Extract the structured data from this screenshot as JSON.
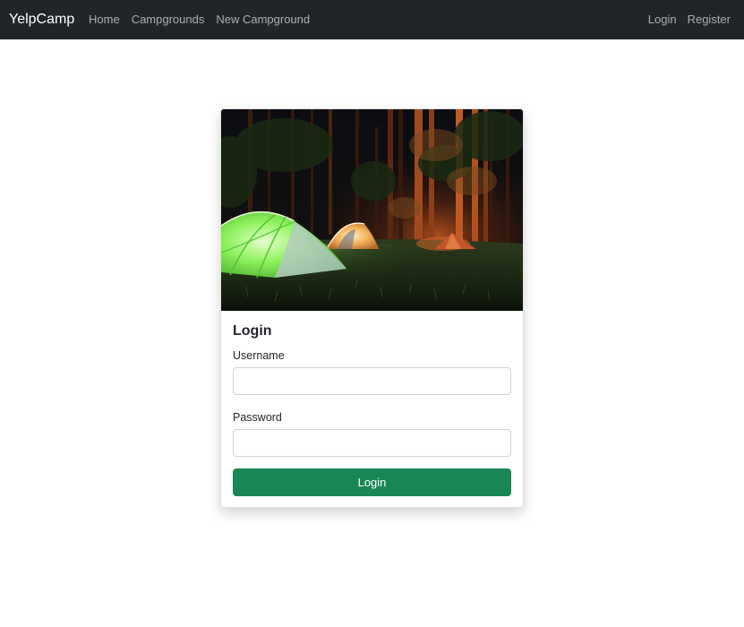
{
  "navbar": {
    "brand": "YelpCamp",
    "left_links": [
      "Home",
      "Campgrounds",
      "New Campground"
    ],
    "right_links": [
      "Login",
      "Register"
    ]
  },
  "login_card": {
    "image": "night-campsite-tents-forest-photo",
    "title": "Login",
    "username_label": "Username",
    "username_value": "",
    "password_label": "Password",
    "password_value": "",
    "submit_label": "Login"
  },
  "colors": {
    "navbar_bg": "#212529",
    "button_green": "#198754"
  }
}
